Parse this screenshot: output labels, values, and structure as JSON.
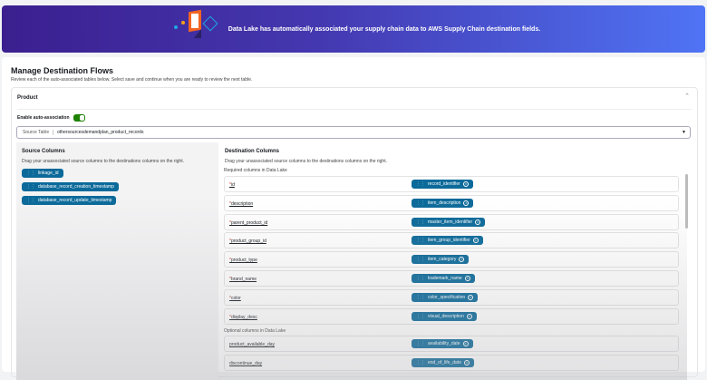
{
  "banner": {
    "message": "Data Lake has automatically associated your supply chain data to AWS Supply Chain destination fields."
  },
  "page": {
    "title": "Manage Destination Flows",
    "subtitle": "Review each of the auto-associated tables below. Select save and continue when you are ready to review the next table."
  },
  "panel": {
    "title": "Product",
    "auto_label": "Enable auto-association",
    "auto_enabled": true,
    "source_label": "Source Table",
    "source_value": "othersourcesdemandplan_product_records"
  },
  "source": {
    "title": "Source Columns",
    "hint": "Drag your unassociated source columns to the destinations columns on the right.",
    "chips": [
      "linkage_id",
      "database_record_creation_timestamp",
      "database_record_update_timestamp"
    ]
  },
  "dest": {
    "title": "Destination Columns",
    "hint": "Drag your unassociated source columns to the destinations columns on the right.",
    "required_label": "Required columns in Data Lake",
    "optional_label": "Optional columns in Data Lake",
    "required": [
      {
        "name": "id",
        "chip": "record_identifier"
      },
      {
        "name": "description",
        "chip": "item_description"
      },
      {
        "name": "parent_product_id",
        "chip": "master_item_identifier"
      },
      {
        "name": "product_group_id",
        "chip": "item_group_identifier"
      },
      {
        "name": "product_type",
        "chip": "item_category"
      },
      {
        "name": "brand_name",
        "chip": "trademark_name"
      },
      {
        "name": "color",
        "chip": "color_specification"
      },
      {
        "name": "display_desc",
        "chip": "visual_description"
      }
    ],
    "optional": [
      {
        "name": "product_available_day",
        "chip": "availability_date"
      },
      {
        "name": "discontinue_day",
        "chip": "end_of_life_date"
      }
    ]
  },
  "colors": {
    "chip": "#0b6a9a",
    "toggle": "#1d8102"
  }
}
